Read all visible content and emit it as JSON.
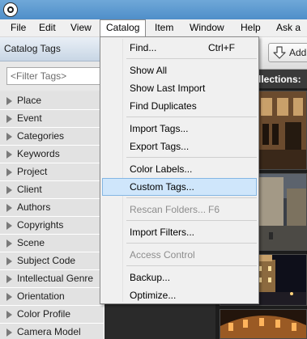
{
  "window": {
    "app_icon": "app-logo-icon"
  },
  "menubar": {
    "items": [
      {
        "label": "File",
        "active": false
      },
      {
        "label": "Edit",
        "active": false
      },
      {
        "label": "View",
        "active": false
      },
      {
        "label": "Catalog",
        "active": true
      },
      {
        "label": "Item",
        "active": false
      },
      {
        "label": "Window",
        "active": false
      },
      {
        "label": "Help",
        "active": false
      },
      {
        "label": "Ask a",
        "active": false
      }
    ]
  },
  "sidebar": {
    "title": "Catalog Tags",
    "filter_placeholder": "<Filter Tags>",
    "tags": [
      "Place",
      "Event",
      "Categories",
      "Keywords",
      "Project",
      "Client",
      "Authors",
      "Copyrights",
      "Scene",
      "Subject Code",
      "Intellectual Genre",
      "Orientation",
      "Color Profile",
      "Camera Model"
    ]
  },
  "toolbar": {
    "add_label": "Add",
    "add_icon": "add-arrow-icon"
  },
  "collections": {
    "label": "llections:"
  },
  "catalog_menu": {
    "groups": [
      [
        {
          "label": "Find...",
          "shortcut": "Ctrl+F",
          "enabled": true,
          "highlighted": false
        }
      ],
      [
        {
          "label": "Show All",
          "shortcut": "",
          "enabled": true,
          "highlighted": false
        },
        {
          "label": "Show Last Import",
          "shortcut": "",
          "enabled": true,
          "highlighted": false
        },
        {
          "label": "Find Duplicates",
          "shortcut": "",
          "enabled": true,
          "highlighted": false
        }
      ],
      [
        {
          "label": "Import Tags...",
          "shortcut": "",
          "enabled": true,
          "highlighted": false
        },
        {
          "label": "Export Tags...",
          "shortcut": "",
          "enabled": true,
          "highlighted": false
        }
      ],
      [
        {
          "label": "Color Labels...",
          "shortcut": "",
          "enabled": true,
          "highlighted": false
        },
        {
          "label": "Custom Tags...",
          "shortcut": "",
          "enabled": true,
          "highlighted": true
        }
      ],
      [
        {
          "label": "Rescan Folders...",
          "shortcut": "F6",
          "enabled": false,
          "highlighted": false
        }
      ],
      [
        {
          "label": "Import Filters...",
          "shortcut": "",
          "enabled": true,
          "highlighted": false
        }
      ],
      [
        {
          "label": "Access Control",
          "shortcut": "",
          "enabled": false,
          "highlighted": false
        }
      ],
      [
        {
          "label": "Backup...",
          "shortcut": "",
          "enabled": true,
          "highlighted": false
        },
        {
          "label": "Optimize...",
          "shortcut": "",
          "enabled": true,
          "highlighted": false
        }
      ]
    ]
  },
  "thumbnails": [
    {
      "name": "photo-thumbnail-building-lantern"
    },
    {
      "name": "photo-thumbnail-plaza"
    },
    {
      "name": "photo-thumbnail-night-tower"
    },
    {
      "name": "photo-thumbnail-arena"
    }
  ]
}
